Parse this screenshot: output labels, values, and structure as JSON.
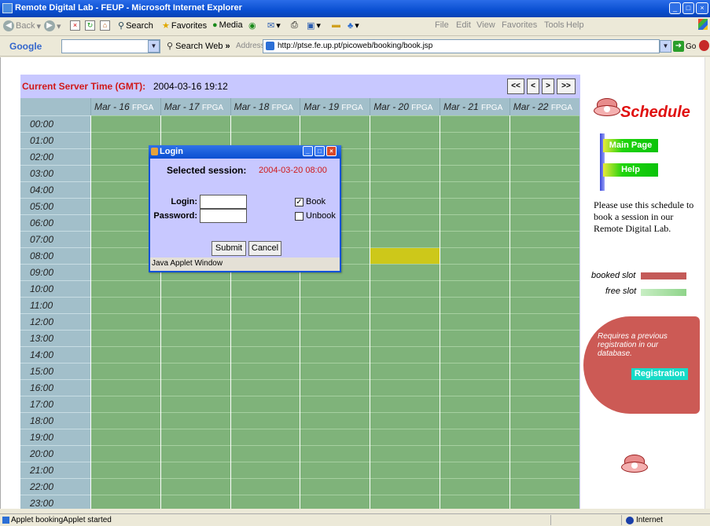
{
  "window": {
    "title": "Remote Digital Lab - FEUP - Microsoft Internet Explorer"
  },
  "toolbar": {
    "back": "Back",
    "search": "Search",
    "favorites": "Favorites",
    "media": "Media",
    "menu_file": "File",
    "menu_edit": "Edit",
    "menu_view": "View",
    "menu_favorites": "Favorites",
    "menu_tools": "Tools",
    "menu_help": "Help"
  },
  "google_bar": {
    "logo": "Google",
    "search_web": "Search Web",
    "more": "»"
  },
  "address_bar": {
    "label": "Address",
    "url": "http://ptse.fe.up.pt/picoweb/booking/book.jsp",
    "go": "Go"
  },
  "schedule": {
    "server_time_label": "Current Server Time (GMT):",
    "server_time_value": "2004-03-16 19:12",
    "nav": [
      "<<",
      "<",
      ">",
      ">>"
    ],
    "days": [
      {
        "date": "Mar - 16",
        "tag": "FPGA"
      },
      {
        "date": "Mar - 17",
        "tag": "FPGA"
      },
      {
        "date": "Mar - 18",
        "tag": "FPGA"
      },
      {
        "date": "Mar - 19",
        "tag": "FPGA"
      },
      {
        "date": "Mar - 20",
        "tag": "FPGA"
      },
      {
        "date": "Mar - 21",
        "tag": "FPGA"
      },
      {
        "date": "Mar - 22",
        "tag": "FPGA"
      }
    ],
    "hours": [
      "00:00",
      "01:00",
      "02:00",
      "03:00",
      "04:00",
      "05:00",
      "06:00",
      "07:00",
      "08:00",
      "09:00",
      "10:00",
      "11:00",
      "12:00",
      "13:00",
      "14:00",
      "15:00",
      "16:00",
      "17:00",
      "18:00",
      "19:00",
      "20:00",
      "21:00",
      "22:00",
      "23:00"
    ],
    "selected_slot": {
      "day": 4,
      "hour": 8
    },
    "colors": {
      "free": "#7fb37a",
      "selected": "#cdc81a",
      "header": "#a2bfca",
      "background": "#c8c8ff"
    }
  },
  "login_dialog": {
    "title": "Login",
    "session_label": "Selected session:",
    "session_value": "2004-03-20 08:00",
    "login_label": "Login:",
    "password_label": "Password:",
    "login_value": "",
    "password_value": "",
    "book_label": "Book",
    "book_checked": true,
    "unbook_label": "Unbook",
    "unbook_checked": false,
    "submit": "Submit",
    "cancel": "Cancel",
    "footer": "Java Applet Window"
  },
  "sidebar": {
    "title": "Schedule",
    "main_page": "Main Page",
    "help": "Help",
    "info": "Please use this schedule to book a session in our Remote Digital Lab.",
    "legend_booked": "booked slot",
    "legend_free": "free slot",
    "booked_color": "#c45a58",
    "free_color": "#8fd48a",
    "registration_note": "Requires a previous registration in our database.",
    "registration_button": "Registration"
  },
  "status_bar": {
    "text": "Applet bookingApplet started",
    "zone": "Internet"
  }
}
